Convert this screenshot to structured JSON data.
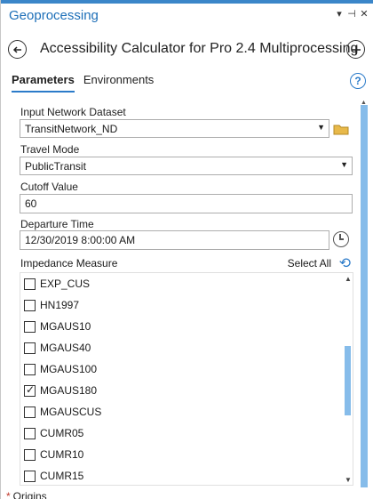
{
  "pane_title": "Geoprocessing",
  "tool_title": "Accessibility Calculator for Pro 2.4 Multiprocessing",
  "tabs": [
    "Parameters",
    "Environments"
  ],
  "params": {
    "network_label": "Input Network Dataset",
    "network_value": "TransitNetwork_ND",
    "travel_mode_label": "Travel Mode",
    "travel_mode_value": "PublicTransit",
    "cutoff_label": "Cutoff Value",
    "cutoff_value": "60",
    "departure_label": "Departure Time",
    "departure_value": "12/30/2019 8:00:00 AM",
    "impedance_label": "Impedance Measure",
    "select_all": "Select All",
    "origins_label": "Origins"
  },
  "impedance_items": [
    {
      "label": "EXP_CUS",
      "checked": false
    },
    {
      "label": "HN1997",
      "checked": false
    },
    {
      "label": "MGAUS10",
      "checked": false
    },
    {
      "label": "MGAUS40",
      "checked": false
    },
    {
      "label": "MGAUS100",
      "checked": false
    },
    {
      "label": "MGAUS180",
      "checked": true
    },
    {
      "label": "MGAUSCUS",
      "checked": false
    },
    {
      "label": "CUMR05",
      "checked": false
    },
    {
      "label": "CUMR10",
      "checked": false
    },
    {
      "label": "CUMR15",
      "checked": false
    }
  ],
  "colors": {
    "accent": "#2b7bc9",
    "title": "#1d6fb8",
    "scroll_thumb": "#86bcea"
  }
}
